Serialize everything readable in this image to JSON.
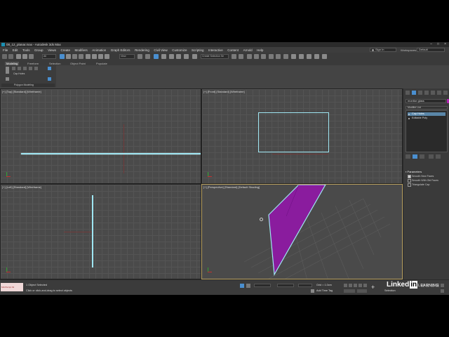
{
  "window": {
    "title": "08_12_planar.max - Autodesk 3ds Max"
  },
  "menu": [
    "File",
    "Edit",
    "Tools",
    "Group",
    "Views",
    "Create",
    "Modifiers",
    "Animation",
    "Graph Editors",
    "Rendering",
    "Civil View",
    "Customize",
    "Scripting",
    "Interactive",
    "Content",
    "Arnold",
    "Help"
  ],
  "signin": {
    "label": "Sign In"
  },
  "workspaces": {
    "label": "Workspaces:",
    "value": "Default"
  },
  "toolbar": {
    "filter": "All",
    "view": "View",
    "selection_set": "Create Selection Se"
  },
  "ribbon": {
    "tabs": [
      "Modeling",
      "Freeform",
      "Selection",
      "Object Paint",
      "Populate"
    ],
    "cap_holes": "Cap Holes",
    "footer": "Polygon Modeling"
  },
  "viewports": {
    "top": "[+] [Top] [Standard] [Wireframe]",
    "front": "[+] [Front] [Standard] [Wireframe]",
    "left": "[+] [Left] [Standard] [Wireframe]",
    "perspective": "[+] [Perspective] [Standard] [Default Shading]"
  },
  "command_panel": {
    "object_name": "monitor glass",
    "object_color": "#b023b0",
    "modifier_list": "Modifier List",
    "stack": [
      "Cap Holes",
      "Editable Poly"
    ],
    "rollout": "Parameters",
    "options": [
      {
        "label": "Smooth New Faces",
        "checked": true
      },
      {
        "label": "Smooth With Old Faces",
        "checked": false
      },
      {
        "label": "Triangulate Cap",
        "checked": false
      }
    ]
  },
  "status": {
    "maxscript": "MAXScript Mi",
    "selected": "1 Object Selected",
    "hint": "Click or click-and-drag to select objects",
    "grid": "Grid = 1.0cm",
    "add_time_tag": "Add Time Tag",
    "frame": "0",
    "selector": "Selection"
  },
  "watermark": {
    "brand": "Linked",
    "box": "in",
    "suffix": "LEARNING"
  },
  "colors": {
    "selection": "#9fe6f2",
    "object": "#8a1c9e"
  }
}
